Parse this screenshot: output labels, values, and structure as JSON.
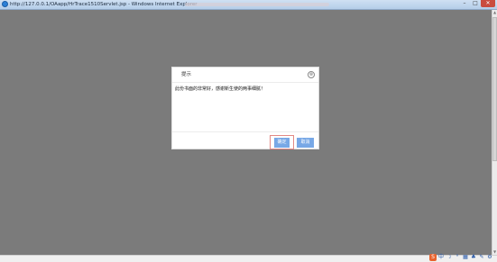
{
  "window": {
    "title": "http://127.0.0.1/OAapp/HrTrace1510Servlet.jsp - Windows Internet Explorer",
    "minimize_glyph": "–",
    "maximize_glyph": "□",
    "close_glyph": "✕"
  },
  "dialog": {
    "title": "提示",
    "close_glyph": "⊗",
    "message": "此份书面的非常好，感谢新生使的两事细腻！",
    "confirm_label": "确定",
    "cancel_label": "取消"
  },
  "scrollbar": {
    "up_glyph": "▲",
    "down_glyph": "▼"
  },
  "tray": {
    "items": [
      {
        "label": "S",
        "icon": "sogou-icon"
      },
      {
        "label": "中",
        "icon": "chinese-input-icon"
      },
      {
        "label": "☽",
        "icon": "moon-icon"
      },
      {
        "label": "°",
        "icon": "punctuation-icon"
      },
      {
        "label": "▦",
        "icon": "keyboard-icon"
      },
      {
        "label": "♣",
        "icon": "skin-icon"
      },
      {
        "label": "✎",
        "icon": "toolbox-icon"
      },
      {
        "label": "⚙",
        "icon": "settings-icon"
      }
    ]
  },
  "colors": {
    "overlay": "#7b7b7b",
    "button_blue": "#78a8e6",
    "focus_outline": "#e28a86"
  }
}
